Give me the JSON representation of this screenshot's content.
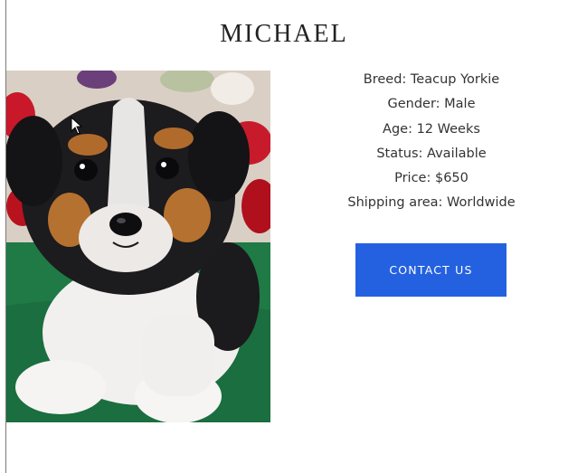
{
  "listing": {
    "name": "MICHAEL",
    "photo_alt": "Teacup Yorkie puppy photo"
  },
  "details": {
    "breed": "Breed: Teacup Yorkie",
    "gender": "Gender: Male",
    "age": "Age: 12 Weeks",
    "status": "Status: Available",
    "price": "Price: $650",
    "shipping": "Shipping area: Worldwide"
  },
  "actions": {
    "contact_label": "CONTACT US"
  },
  "colors": {
    "accent": "#2461e0",
    "title": "#222222",
    "text": "#333333"
  }
}
